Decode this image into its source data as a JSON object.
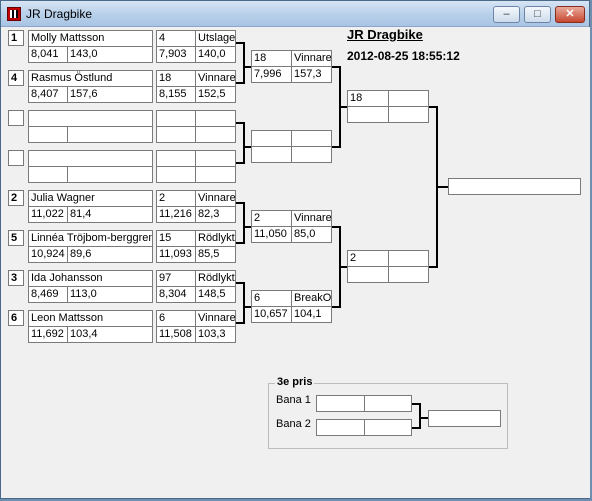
{
  "window": {
    "title": "JR Dragbike",
    "minimize": "–",
    "maximize": "□",
    "close": "✕"
  },
  "header": {
    "title": "JR Dragbike",
    "datetime": "2012-08-25 18:55:12"
  },
  "round1": [
    {
      "seed": "1",
      "name": "Molly Mattsson",
      "rt": "8,041",
      "speed": "143,0",
      "opp_num": "4",
      "opp_res": "Utslagen",
      "opp_rt": "7,903",
      "opp_speed": "140,0"
    },
    {
      "seed": "4",
      "name": "Rasmus Östlund",
      "rt": "8,407",
      "speed": "157,6",
      "opp_num": "18",
      "opp_res": "Vinnare",
      "opp_rt": "8,155",
      "opp_speed": "152,5"
    },
    {
      "seed": "",
      "name": "",
      "rt": "",
      "speed": "",
      "opp_num": "",
      "opp_res": "",
      "opp_rt": "",
      "opp_speed": ""
    },
    {
      "seed": "",
      "name": "",
      "rt": "",
      "speed": "",
      "opp_num": "",
      "opp_res": "",
      "opp_rt": "",
      "opp_speed": ""
    },
    {
      "seed": "2",
      "name": "Julia Wagner",
      "rt": "11,022",
      "speed": "81,4",
      "opp_num": "2",
      "opp_res": "Vinnare",
      "opp_rt": "11,216",
      "opp_speed": "82,3"
    },
    {
      "seed": "5",
      "name": "Linnéa Tröjbom-berggren",
      "rt": "10,924",
      "speed": "89,6",
      "opp_num": "15",
      "opp_res": "Rödlyktan",
      "opp_rt": "11,093",
      "opp_speed": "85,5"
    },
    {
      "seed": "3",
      "name": "Ida Johansson",
      "rt": "8,469",
      "speed": "113,0",
      "opp_num": "97",
      "opp_res": "Rödlyktan",
      "opp_rt": "8,304",
      "opp_speed": "148,5"
    },
    {
      "seed": "6",
      "name": "Leon Mattsson",
      "rt": "11,692",
      "speed": "103,4",
      "opp_num": "6",
      "opp_res": "Vinnare",
      "opp_rt": "11,508",
      "opp_speed": "103,3"
    }
  ],
  "round2": [
    {
      "num": "18",
      "res": "Vinnare",
      "rt": "7,996",
      "speed": "157,3"
    },
    {
      "num": "",
      "res": "",
      "rt": "",
      "speed": ""
    },
    {
      "num": "2",
      "res": "Vinnare",
      "rt": "11,050",
      "speed": "85,0"
    },
    {
      "num": "6",
      "res": "BreakOut",
      "rt": "10,657",
      "speed": "104,1"
    }
  ],
  "round3": [
    {
      "num": "18",
      "res": "",
      "rt": "",
      "speed": ""
    },
    {
      "num": "2",
      "res": "",
      "rt": "",
      "speed": ""
    }
  ],
  "final": {
    "value": ""
  },
  "third_place": {
    "legend": "3e pris",
    "lane1_label": "Bana 1",
    "lane2_label": "Bana 2",
    "winner": ""
  }
}
